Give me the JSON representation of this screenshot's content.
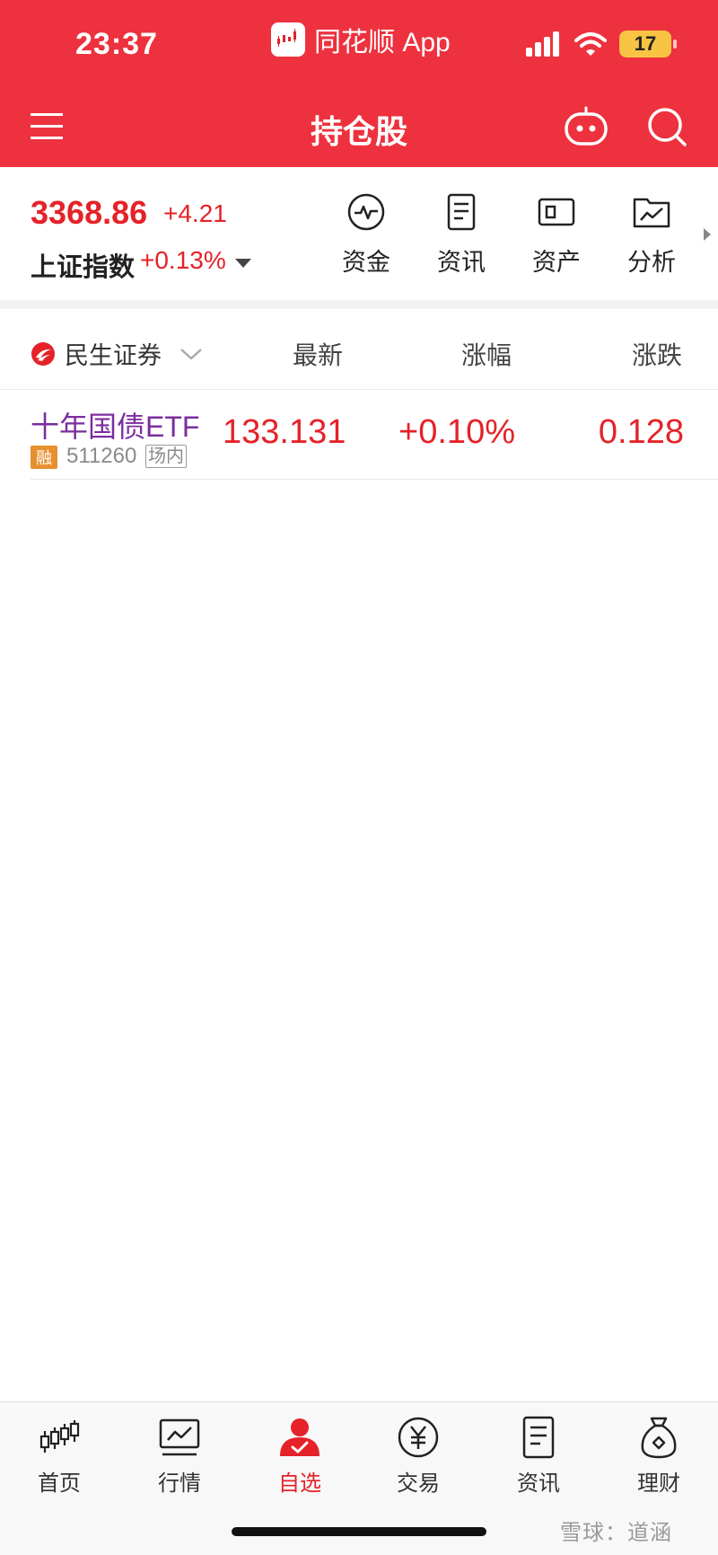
{
  "status_bar": {
    "time": "23:37",
    "app_name": "同花顺 App",
    "battery": "17"
  },
  "nav": {
    "title": "持仓股"
  },
  "index": {
    "value": "3368.86",
    "change": "+4.21",
    "name": "上证指数",
    "percent": "+0.13%"
  },
  "quick_actions": [
    {
      "label": "资金",
      "icon": "capital-flow-icon"
    },
    {
      "label": "资讯",
      "icon": "news-icon"
    },
    {
      "label": "资产",
      "icon": "assets-icon"
    },
    {
      "label": "分析",
      "icon": "analysis-icon"
    }
  ],
  "table": {
    "broker": "民生证券",
    "columns": [
      "最新",
      "涨幅",
      "涨跌"
    ],
    "rows": [
      {
        "name": "十年国债ETF",
        "tag_margin": "融",
        "code": "511260",
        "tag_exchange": "场内",
        "latest": "133.131",
        "change_pct": "+0.10%",
        "change": "0.128"
      }
    ]
  },
  "tabbar": {
    "items": [
      {
        "label": "首页",
        "icon": "candlestick-icon",
        "active": false
      },
      {
        "label": "行情",
        "icon": "market-chart-icon",
        "active": false
      },
      {
        "label": "自选",
        "icon": "watchlist-person-icon",
        "active": true
      },
      {
        "label": "交易",
        "icon": "yuan-coin-icon",
        "active": false
      },
      {
        "label": "资讯",
        "icon": "news-icon",
        "active": false
      },
      {
        "label": "理财",
        "icon": "money-bag-icon",
        "active": false
      }
    ]
  },
  "watermark": "雪球：道涵",
  "colors": {
    "brand_red": "#ee313e",
    "price_red": "#e42228",
    "stock_name_purple": "#7b2d9e",
    "margin_tag_orange": "#e7902f"
  }
}
